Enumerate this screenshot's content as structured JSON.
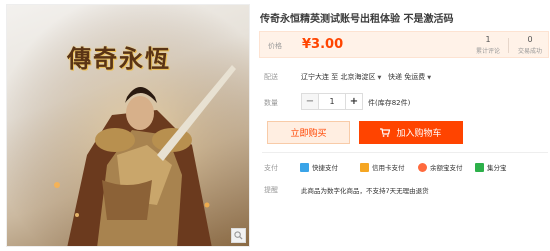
{
  "product": {
    "title": "传奇永恒精英测试账号出租体验 不是激活码",
    "image_logo_text": "傳奇永恆"
  },
  "price": {
    "label": "价格",
    "value": "¥3.00",
    "stats": [
      {
        "num": "1",
        "label": "累计评论"
      },
      {
        "num": "0",
        "label": "交易成功"
      }
    ]
  },
  "shipping": {
    "label": "配送",
    "route": "辽宁大连 至 北京海淀区",
    "method": "快递 免运费"
  },
  "quantity": {
    "label": "数量",
    "minus": "−",
    "value": "1",
    "plus": "+",
    "stock": "件(库存82件)"
  },
  "actions": {
    "buy_now": "立即购买",
    "add_cart": "加入购物车"
  },
  "payment": {
    "label": "支付",
    "methods": [
      {
        "name": "快捷支付",
        "color": "#3aa4e8"
      },
      {
        "name": "信用卡支付",
        "color": "#f5a623"
      },
      {
        "name": "余额宝支付",
        "color": "#ff6a3d"
      },
      {
        "name": "集分宝",
        "color": "#2db04a"
      }
    ]
  },
  "notice": {
    "label": "提醒",
    "text": "此商品为数字化商品，不支持7天无理由退货"
  },
  "colors": {
    "accent": "#ff4400",
    "price_bg": "#fff2e8"
  }
}
